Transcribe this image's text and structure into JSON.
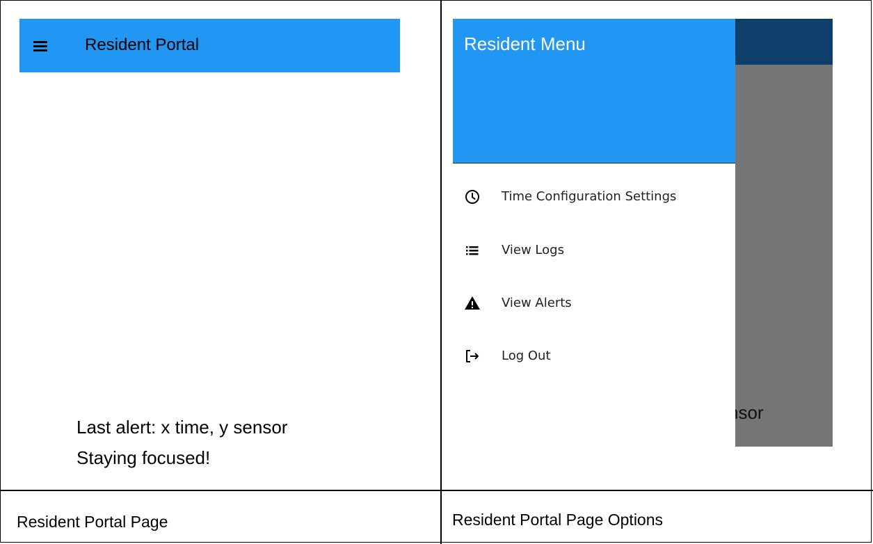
{
  "left_screen": {
    "app_bar": {
      "title": "Resident Portal"
    },
    "status": {
      "last_alert": "Last alert: x time, y sensor",
      "message": "Staying focused!"
    },
    "caption": "Resident Portal Page"
  },
  "right_screen": {
    "drawer": {
      "header_title": "Resident Menu",
      "items": [
        {
          "label": "Time Configuration Settings",
          "icon": "clock-icon"
        },
        {
          "label": "View Logs",
          "icon": "list-icon"
        },
        {
          "label": "View Alerts",
          "icon": "warning-icon"
        },
        {
          "label": "Log Out",
          "icon": "logout-icon"
        }
      ]
    },
    "background_text_fragment": "nsor",
    "caption": "Resident Portal Page Options"
  },
  "colors": {
    "app_bar": "#2196f3",
    "app_bar_dimmed": "#0e3f6b",
    "scrim": "#757575"
  }
}
